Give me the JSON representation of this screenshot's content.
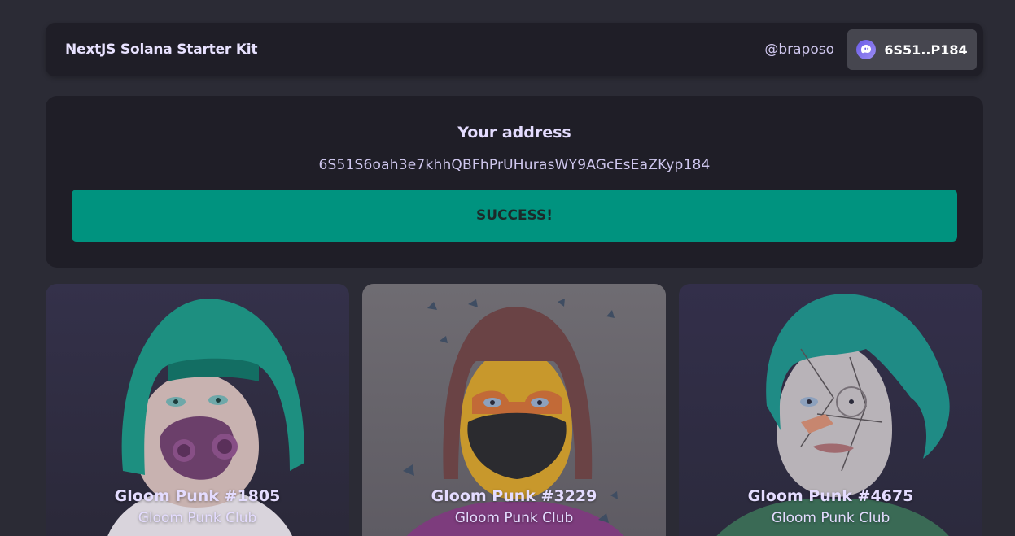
{
  "navbar": {
    "brand": "NextJS Solana Starter Kit",
    "handle": "@braposo",
    "wallet_label": "6S51..P184",
    "wallet_icon": "phantom-ghost-icon"
  },
  "address_panel": {
    "title": "Your address",
    "address": "6S51S6oah3e7khhQBFhPrUHurasWY9AGcEsEaZKyp184",
    "status_button": "SUCCESS!"
  },
  "nfts": [
    {
      "name": "Gloom Punk #1805",
      "collection": "Gloom Punk Club"
    },
    {
      "name": "Gloom Punk #3229",
      "collection": "Gloom Punk Club"
    },
    {
      "name": "Gloom Punk #4675",
      "collection": "Gloom Punk Club"
    }
  ],
  "colors": {
    "background": "#2b2b35",
    "panel": "#1f1e27",
    "success": "#00937f",
    "wallet_button": "#46464f",
    "text": "#e4dcff"
  }
}
